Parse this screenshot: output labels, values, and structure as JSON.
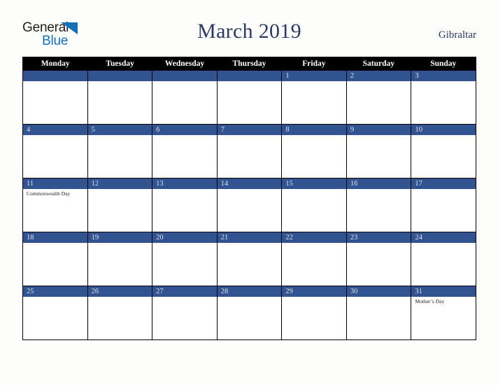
{
  "brand": {
    "name_top": "General",
    "name_bottom": "Blue",
    "color_dark": "#231f20",
    "color_blue": "#1271b9"
  },
  "header": {
    "title": "March 2019",
    "country": "Gibraltar",
    "title_color": "#2b3a63"
  },
  "calendar": {
    "accent_color": "#31538f",
    "header_bg": "#000000",
    "day_names": [
      "Monday",
      "Tuesday",
      "Wednesday",
      "Thursday",
      "Friday",
      "Saturday",
      "Sunday"
    ],
    "weeks": [
      [
        {
          "date": "",
          "events": []
        },
        {
          "date": "",
          "events": []
        },
        {
          "date": "",
          "events": []
        },
        {
          "date": "",
          "events": []
        },
        {
          "date": "1",
          "events": []
        },
        {
          "date": "2",
          "events": []
        },
        {
          "date": "3",
          "events": []
        }
      ],
      [
        {
          "date": "4",
          "events": []
        },
        {
          "date": "5",
          "events": []
        },
        {
          "date": "6",
          "events": []
        },
        {
          "date": "7",
          "events": []
        },
        {
          "date": "8",
          "events": []
        },
        {
          "date": "9",
          "events": []
        },
        {
          "date": "10",
          "events": []
        }
      ],
      [
        {
          "date": "11",
          "events": [
            "Commonwealth Day"
          ]
        },
        {
          "date": "12",
          "events": []
        },
        {
          "date": "13",
          "events": []
        },
        {
          "date": "14",
          "events": []
        },
        {
          "date": "15",
          "events": []
        },
        {
          "date": "16",
          "events": []
        },
        {
          "date": "17",
          "events": []
        }
      ],
      [
        {
          "date": "18",
          "events": []
        },
        {
          "date": "19",
          "events": []
        },
        {
          "date": "20",
          "events": []
        },
        {
          "date": "21",
          "events": []
        },
        {
          "date": "22",
          "events": []
        },
        {
          "date": "23",
          "events": []
        },
        {
          "date": "24",
          "events": []
        }
      ],
      [
        {
          "date": "25",
          "events": []
        },
        {
          "date": "26",
          "events": []
        },
        {
          "date": "27",
          "events": []
        },
        {
          "date": "28",
          "events": []
        },
        {
          "date": "29",
          "events": []
        },
        {
          "date": "30",
          "events": []
        },
        {
          "date": "31",
          "events": [
            "Mother’s Day"
          ]
        }
      ]
    ]
  }
}
